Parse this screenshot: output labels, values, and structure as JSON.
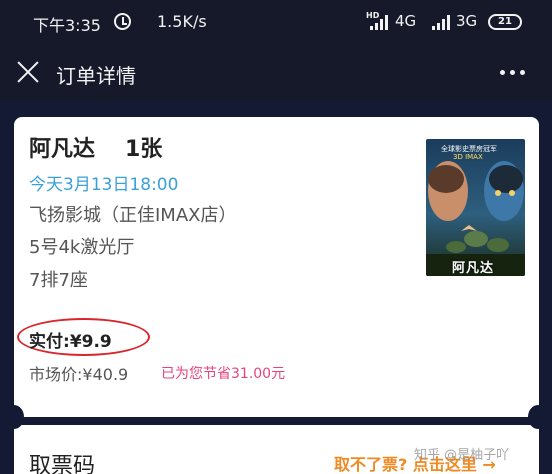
{
  "status_bar": {
    "time": "下午3:35",
    "network_speed": "1.5K/s",
    "hd_label": "HD",
    "network_1": "4G",
    "network_2": "3G",
    "battery": "21"
  },
  "nav": {
    "title": "订单详情"
  },
  "order": {
    "movie_title": "阿凡达",
    "ticket_count": "1张",
    "showtime": "今天3月13日18:00",
    "cinema": "飞扬影城（正佳IMAX店）",
    "hall": "5号4k激光厅",
    "seat": "7排7座",
    "paid_label": "实付:",
    "paid_value": "¥9.9",
    "market_label": "市场价:",
    "market_value": "¥40.9",
    "saved_text": "已为您节省31.00元",
    "poster": {
      "caption": "阿凡达",
      "tag_line_1": "全球影史票房冠军",
      "tag_line_2": "3D IMAX"
    }
  },
  "pickup": {
    "title": "取票码",
    "help_link": "取不了票? 点击这里 →"
  },
  "watermark": "知乎 @是柚子吖",
  "colors": {
    "background_dark": "#141a33",
    "showtime_blue": "#3aa0d8",
    "saved_pink": "#e8447a",
    "help_orange": "#f08a24",
    "highlight_red": "#d8262a"
  }
}
